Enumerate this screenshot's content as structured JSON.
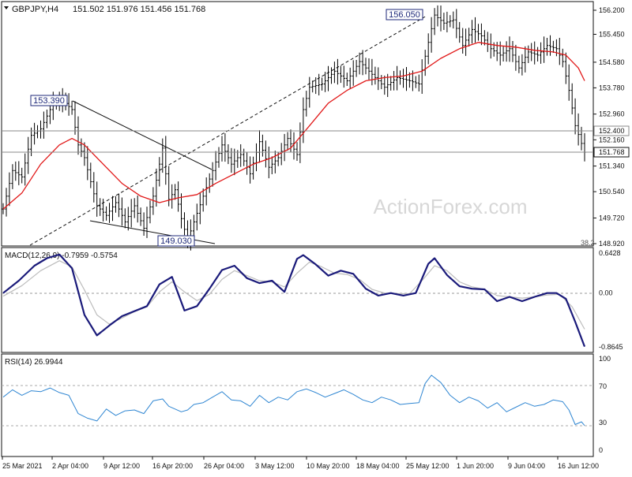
{
  "header": {
    "symbol": "GBPJPY,H4",
    "ohlc": "151.502 151.976 151.456 151.768"
  },
  "watermark": "ActionForex.com",
  "colors": {
    "price_bar": "#000000",
    "ma": "#e11818",
    "macd_main": "#1a1a7a",
    "macd_signal": "#bcbcbc",
    "rsi": "#2f86d2",
    "grid_dash": "#9a9a9a",
    "label_bg": "#ffffff",
    "label_border": "#1f2a7a",
    "label_text": "#1f2a7a",
    "watermark": "#d7d7d7"
  },
  "price_axis": {
    "ticks": [
      "156.200",
      "155.450",
      "154.580",
      "153.780",
      "152.960",
      "152.160",
      "151.340",
      "150.540",
      "149.720",
      "148.920"
    ],
    "min": 148.92,
    "max": 156.2,
    "current_label": "151.768",
    "level_label": "152.400",
    "fib_label": "38.2"
  },
  "annotations": {
    "high_1": "153.390",
    "low_1": "149.030",
    "high_2": "156.050"
  },
  "macd": {
    "label": "MACD(12,26,9) -0.7959 -0.5754",
    "ticks": [
      "0.6428",
      "0.00",
      "-0.8645"
    ]
  },
  "rsi": {
    "label": "RSI(14) 26.9944",
    "ticks": [
      "100",
      "70",
      "30",
      "0"
    ]
  },
  "time_axis": [
    "25 Mar 2021",
    "2 Apr 04:00",
    "9 Apr 12:00",
    "16 Apr 20:00",
    "26 Apr 04:00",
    "3 May 12:00",
    "10 May 20:00",
    "18 May 04:00",
    "25 May 12:00",
    "1 Jun 20:00",
    "9 Jun 04:00",
    "16 Jun 12:00"
  ],
  "chart_data": {
    "type": "line",
    "title": "GBPJPY,H4",
    "ylim": [
      148.92,
      156.2
    ],
    "price_path": [
      [
        0,
        150.0
      ],
      [
        3,
        151.2
      ],
      [
        6,
        151.0
      ],
      [
        9,
        152.3
      ],
      [
        12,
        152.5
      ],
      [
        16,
        153.3
      ],
      [
        19,
        153.39
      ],
      [
        22,
        153.1
      ],
      [
        24,
        152.0
      ],
      [
        26,
        151.6
      ],
      [
        30,
        150.1
      ],
      [
        33,
        149.8
      ],
      [
        36,
        150.2
      ],
      [
        39,
        149.6
      ],
      [
        42,
        150.1
      ],
      [
        45,
        149.4
      ],
      [
        48,
        150.4
      ],
      [
        51,
        151.9
      ],
      [
        53,
        150.3
      ],
      [
        55,
        150.6
      ],
      [
        57,
        149.7
      ],
      [
        59,
        149.03
      ],
      [
        61,
        149.6
      ],
      [
        64,
        150.4
      ],
      [
        67,
        151.2
      ],
      [
        70,
        152.0
      ],
      [
        73,
        151.4
      ],
      [
        76,
        151.7
      ],
      [
        79,
        151.1
      ],
      [
        82,
        152.1
      ],
      [
        85,
        151.3
      ],
      [
        88,
        151.6
      ],
      [
        91,
        152.2
      ],
      [
        94,
        151.7
      ],
      [
        96,
        153.1
      ],
      [
        98,
        153.8
      ],
      [
        102,
        153.9
      ],
      [
        106,
        154.3
      ],
      [
        110,
        154.0
      ],
      [
        114,
        154.6
      ],
      [
        118,
        154.2
      ],
      [
        122,
        153.8
      ],
      [
        126,
        154.1
      ],
      [
        130,
        154.0
      ],
      [
        133,
        153.9
      ],
      [
        136,
        155.2
      ],
      [
        138,
        156.05
      ],
      [
        141,
        155.8
      ],
      [
        144,
        155.9
      ],
      [
        147,
        155.1
      ],
      [
        150,
        155.6
      ],
      [
        153,
        155.4
      ],
      [
        156,
        155.0
      ],
      [
        159,
        154.8
      ],
      [
        162,
        155.0
      ],
      [
        165,
        154.4
      ],
      [
        168,
        154.9
      ],
      [
        171,
        154.8
      ],
      [
        174,
        155.1
      ],
      [
        177,
        155.0
      ],
      [
        179,
        154.6
      ],
      [
        181,
        153.7
      ],
      [
        183,
        152.6
      ],
      [
        186,
        151.77
      ]
    ],
    "ma_path": [
      [
        0,
        150.0
      ],
      [
        6,
        150.5
      ],
      [
        12,
        151.4
      ],
      [
        18,
        152.0
      ],
      [
        22,
        152.2
      ],
      [
        26,
        152.0
      ],
      [
        32,
        151.4
      ],
      [
        38,
        150.8
      ],
      [
        44,
        150.4
      ],
      [
        50,
        150.2
      ],
      [
        56,
        150.35
      ],
      [
        62,
        150.45
      ],
      [
        68,
        150.8
      ],
      [
        74,
        151.1
      ],
      [
        80,
        151.4
      ],
      [
        86,
        151.6
      ],
      [
        92,
        151.9
      ],
      [
        98,
        152.6
      ],
      [
        104,
        153.3
      ],
      [
        110,
        153.7
      ],
      [
        116,
        154.0
      ],
      [
        122,
        154.1
      ],
      [
        128,
        154.15
      ],
      [
        134,
        154.3
      ],
      [
        140,
        154.7
      ],
      [
        146,
        155.0
      ],
      [
        152,
        155.2
      ],
      [
        158,
        155.1
      ],
      [
        164,
        155.05
      ],
      [
        170,
        154.95
      ],
      [
        176,
        154.9
      ],
      [
        180,
        154.8
      ],
      [
        184,
        154.4
      ],
      [
        186,
        154.0
      ]
    ],
    "macd_main": [
      [
        0,
        0.0
      ],
      [
        5,
        0.2
      ],
      [
        10,
        0.44
      ],
      [
        14,
        0.56
      ],
      [
        18,
        0.62
      ],
      [
        22,
        0.4
      ],
      [
        26,
        -0.35
      ],
      [
        30,
        -0.68
      ],
      [
        34,
        -0.52
      ],
      [
        38,
        -0.37
      ],
      [
        42,
        -0.29
      ],
      [
        46,
        -0.21
      ],
      [
        50,
        0.14
      ],
      [
        54,
        0.26
      ],
      [
        58,
        -0.28
      ],
      [
        62,
        -0.21
      ],
      [
        66,
        0.07
      ],
      [
        70,
        0.37
      ],
      [
        74,
        0.44
      ],
      [
        78,
        0.24
      ],
      [
        82,
        0.16
      ],
      [
        86,
        0.2
      ],
      [
        90,
        0.02
      ],
      [
        94,
        0.55
      ],
      [
        96,
        0.61
      ],
      [
        100,
        0.46
      ],
      [
        104,
        0.28
      ],
      [
        108,
        0.36
      ],
      [
        112,
        0.31
      ],
      [
        116,
        0.07
      ],
      [
        120,
        -0.04
      ],
      [
        124,
        0.0
      ],
      [
        128,
        -0.04
      ],
      [
        132,
        0.0
      ],
      [
        136,
        0.47
      ],
      [
        138,
        0.56
      ],
      [
        142,
        0.29
      ],
      [
        146,
        0.11
      ],
      [
        150,
        0.07
      ],
      [
        154,
        0.06
      ],
      [
        158,
        -0.13
      ],
      [
        162,
        -0.06
      ],
      [
        166,
        -0.13
      ],
      [
        170,
        -0.06
      ],
      [
        174,
        0.0
      ],
      [
        177,
        0.0
      ],
      [
        180,
        -0.09
      ],
      [
        183,
        -0.46
      ],
      [
        186,
        -0.86
      ]
    ],
    "macd_signal": [
      [
        0,
        -0.05
      ],
      [
        6,
        0.12
      ],
      [
        12,
        0.36
      ],
      [
        18,
        0.52
      ],
      [
        22,
        0.42
      ],
      [
        26,
        0.05
      ],
      [
        30,
        -0.35
      ],
      [
        34,
        -0.5
      ],
      [
        38,
        -0.4
      ],
      [
        42,
        -0.3
      ],
      [
        46,
        -0.22
      ],
      [
        50,
        0.02
      ],
      [
        54,
        0.18
      ],
      [
        58,
        0.02
      ],
      [
        62,
        -0.12
      ],
      [
        66,
        -0.02
      ],
      [
        70,
        0.22
      ],
      [
        74,
        0.36
      ],
      [
        78,
        0.28
      ],
      [
        82,
        0.2
      ],
      [
        86,
        0.18
      ],
      [
        90,
        0.1
      ],
      [
        94,
        0.32
      ],
      [
        98,
        0.5
      ],
      [
        102,
        0.42
      ],
      [
        106,
        0.32
      ],
      [
        110,
        0.3
      ],
      [
        114,
        0.22
      ],
      [
        118,
        0.06
      ],
      [
        122,
        0.0
      ],
      [
        126,
        -0.01
      ],
      [
        130,
        -0.01
      ],
      [
        134,
        0.2
      ],
      [
        138,
        0.44
      ],
      [
        142,
        0.36
      ],
      [
        146,
        0.18
      ],
      [
        150,
        0.1
      ],
      [
        154,
        0.06
      ],
      [
        158,
        -0.04
      ],
      [
        162,
        -0.06
      ],
      [
        166,
        -0.08
      ],
      [
        170,
        -0.06
      ],
      [
        174,
        -0.03
      ],
      [
        178,
        -0.02
      ],
      [
        182,
        -0.22
      ],
      [
        186,
        -0.58
      ]
    ],
    "rsi_path": [
      [
        0,
        58
      ],
      [
        3,
        66
      ],
      [
        6,
        60
      ],
      [
        9,
        65
      ],
      [
        12,
        64
      ],
      [
        15,
        68
      ],
      [
        18,
        63
      ],
      [
        21,
        60
      ],
      [
        24,
        40
      ],
      [
        27,
        35
      ],
      [
        30,
        32
      ],
      [
        33,
        45
      ],
      [
        36,
        38
      ],
      [
        39,
        43
      ],
      [
        42,
        44
      ],
      [
        45,
        40
      ],
      [
        48,
        54
      ],
      [
        51,
        56
      ],
      [
        53,
        48
      ],
      [
        55,
        45
      ],
      [
        57,
        42
      ],
      [
        59,
        44
      ],
      [
        61,
        50
      ],
      [
        64,
        52
      ],
      [
        67,
        58
      ],
      [
        70,
        64
      ],
      [
        73,
        55
      ],
      [
        76,
        54
      ],
      [
        79,
        48
      ],
      [
        82,
        60
      ],
      [
        85,
        52
      ],
      [
        88,
        58
      ],
      [
        91,
        55
      ],
      [
        94,
        64
      ],
      [
        97,
        67
      ],
      [
        100,
        63
      ],
      [
        103,
        58
      ],
      [
        106,
        62
      ],
      [
        109,
        66
      ],
      [
        112,
        61
      ],
      [
        115,
        55
      ],
      [
        118,
        52
      ],
      [
        121,
        58
      ],
      [
        124,
        55
      ],
      [
        127,
        50
      ],
      [
        130,
        51
      ],
      [
        133,
        52
      ],
      [
        135,
        73
      ],
      [
        137,
        82
      ],
      [
        140,
        74
      ],
      [
        143,
        60
      ],
      [
        146,
        52
      ],
      [
        149,
        58
      ],
      [
        152,
        54
      ],
      [
        155,
        46
      ],
      [
        158,
        52
      ],
      [
        161,
        42
      ],
      [
        164,
        47
      ],
      [
        167,
        52
      ],
      [
        170,
        48
      ],
      [
        173,
        50
      ],
      [
        176,
        55
      ],
      [
        179,
        53
      ],
      [
        181,
        44
      ],
      [
        183,
        28
      ],
      [
        185,
        31
      ],
      [
        186,
        27
      ]
    ]
  }
}
